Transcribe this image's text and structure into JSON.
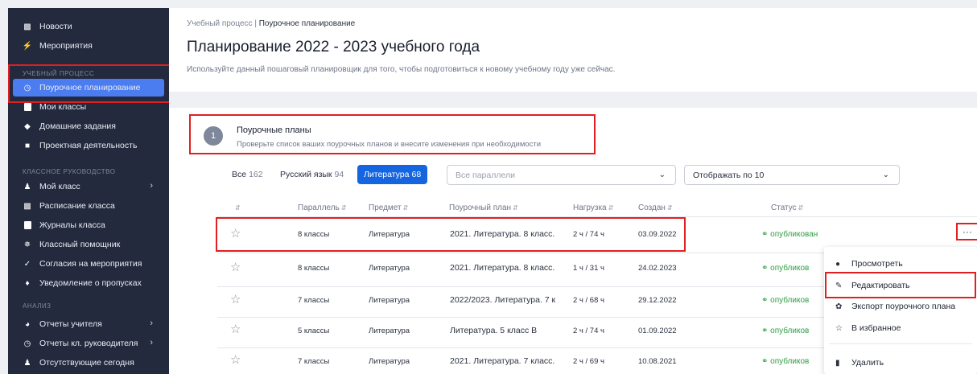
{
  "sidebar": {
    "items_top": [
      {
        "label": "Новости",
        "icon": "calendar-icon"
      },
      {
        "label": "Мероприятия",
        "icon": "lightning-icon"
      }
    ],
    "section_process": "УЧЕБНЫЙ ПРОЦЕСС",
    "items_process": [
      {
        "label": "Поурочное планирование",
        "icon": "clock-icon",
        "active": true
      },
      {
        "label": "Мои классы",
        "icon": "book-icon"
      },
      {
        "label": "Домашние задания",
        "icon": "graduation-cap-icon"
      },
      {
        "label": "Проектная деятельность",
        "icon": "cube-icon"
      }
    ],
    "section_class": "КЛАССНОЕ РУКОВОДСТВО",
    "items_class": [
      {
        "label": "Мой класс",
        "icon": "users-icon",
        "chevron": true
      },
      {
        "label": "Расписание класса",
        "icon": "calendar-icon"
      },
      {
        "label": "Журналы класса",
        "icon": "book-icon"
      },
      {
        "label": "Классный помощник",
        "icon": "sparkle-icon"
      },
      {
        "label": "Согласия на мероприятия",
        "icon": "check-circle-icon"
      },
      {
        "label": "Уведомление о пропусках",
        "icon": "bell-icon"
      }
    ],
    "section_analysis": "АНАЛИЗ",
    "items_analysis": [
      {
        "label": "Отчеты учителя",
        "icon": "pie-chart-icon",
        "chevron": true
      },
      {
        "label": "Отчеты кл. руководителя",
        "icon": "clock-outline-icon",
        "chevron": true
      },
      {
        "label": "Отсутствующие сегодня",
        "icon": "user-absent-icon"
      }
    ]
  },
  "breadcrumb": {
    "parent": "Учебный процесс",
    "separator": "|",
    "current": "Поурочное планирование"
  },
  "page": {
    "title": "Планирование 2022 - 2023 учебного года",
    "subtitle": "Используйте данный пошаговый планировщик для того, чтобы подготовиться к новому учебному году уже сейчас."
  },
  "step": {
    "number": "1",
    "title": "Поурочные планы",
    "description": "Проверьте список ваших поурочных планов и внесите изменения при необходимости"
  },
  "filters": {
    "tabs": [
      {
        "label": "Все",
        "count": "162",
        "active": false
      },
      {
        "label": "Русский язык",
        "count": "94",
        "active": false
      },
      {
        "label": "Литература",
        "count": "68",
        "active": true
      }
    ],
    "parallel_placeholder": "Все параллели",
    "page_size_value": "Отображать по 10"
  },
  "table": {
    "headers": {
      "parallel": "Параллель",
      "subject": "Предмет",
      "plan": "Поурочный план",
      "load": "Нагрузка",
      "created": "Создан",
      "status": "Статус"
    },
    "rows": [
      {
        "parallel": "8 классы",
        "subject": "Литература",
        "plan": "2021. Литература. 8 класс.",
        "load": "2 ч / 74 ч",
        "created": "03.09.2022",
        "status": "опубликован"
      },
      {
        "parallel": "8 классы",
        "subject": "Литература",
        "plan": "2021. Литература. 8 класс.",
        "load": "1 ч / 31 ч",
        "created": "24.02.2023",
        "status": "опубликов"
      },
      {
        "parallel": "7 классы",
        "subject": "Литература",
        "plan": "2022/2023. Литература. 7 к",
        "load": "2 ч / 68 ч",
        "created": "29.12.2022",
        "status": "опубликов"
      },
      {
        "parallel": "5 классы",
        "subject": "Литература",
        "plan": "Литература. 5 класс В",
        "load": "2 ч / 74 ч",
        "created": "01.09.2022",
        "status": "опубликов"
      },
      {
        "parallel": "7 классы",
        "subject": "Литература",
        "plan": "2021. Литература. 7 класс.",
        "load": "2 ч / 69 ч",
        "created": "10.08.2021",
        "status": "опубликов"
      }
    ],
    "more_label": "···"
  },
  "context_menu": {
    "items": [
      {
        "label": "Просмотреть",
        "icon": "info-icon"
      },
      {
        "label": "Редактировать",
        "icon": "pencil-icon"
      },
      {
        "label": "Экспорт поурочного плана",
        "icon": "gear-export-icon"
      },
      {
        "label": "В избранное",
        "icon": "star-icon"
      },
      {
        "label": "Удалить",
        "icon": "trash-icon"
      }
    ]
  },
  "colors": {
    "sidebar_bg": "#232a3e",
    "accent": "#1565e0",
    "sidebar_active": "#4b7cf0",
    "status_green": "#2f9e44",
    "highlight_red": "#e02020"
  }
}
